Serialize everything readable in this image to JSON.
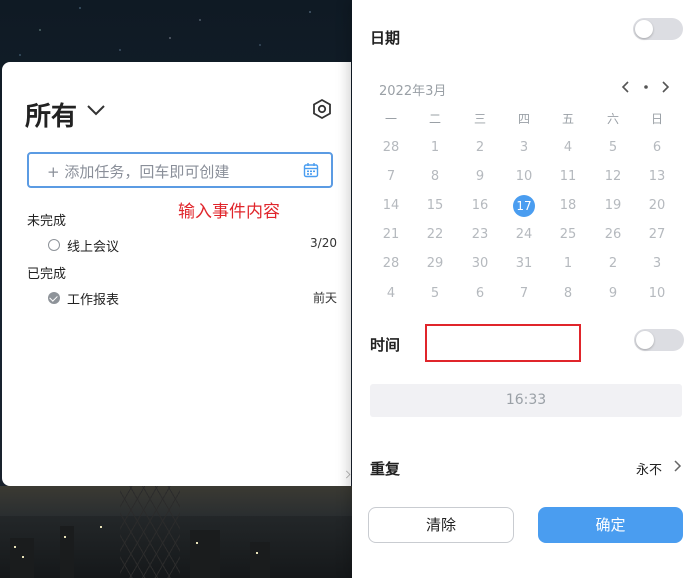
{
  "todo": {
    "list_title": "所有",
    "input_placeholder": "+ 添加任务，回车即可创建",
    "annotation": "输入事件内容",
    "sections": [
      {
        "label": "未完成",
        "tasks": [
          {
            "text": "线上会议",
            "date": "3/20",
            "done": false
          }
        ]
      },
      {
        "label": "已完成",
        "tasks": [
          {
            "text": "工作报表",
            "date": "前天",
            "done": true
          }
        ]
      }
    ]
  },
  "picker": {
    "date_label": "日期",
    "date_toggle_on": false,
    "month_label": "2022年3月",
    "weekdays": [
      "一",
      "二",
      "三",
      "四",
      "五",
      "六",
      "日"
    ],
    "weeks": [
      [
        "28",
        "1",
        "2",
        "3",
        "4",
        "5",
        "6"
      ],
      [
        "7",
        "8",
        "9",
        "10",
        "11",
        "12",
        "13"
      ],
      [
        "14",
        "15",
        "16",
        "17",
        "18",
        "19",
        "20"
      ],
      [
        "21",
        "22",
        "23",
        "24",
        "25",
        "26",
        "27"
      ],
      [
        "28",
        "29",
        "30",
        "31",
        "1",
        "2",
        "3"
      ],
      [
        "4",
        "5",
        "6",
        "7",
        "8",
        "9",
        "10"
      ]
    ],
    "today": "17",
    "time_label": "时间",
    "time_toggle_on": false,
    "time_value": "16:33",
    "repeat_label": "重复",
    "repeat_value": "永不",
    "clear_button": "清除",
    "confirm_button": "确定"
  },
  "colors": {
    "accent": "#4a9df0",
    "annotation": "#e0252b",
    "muted_text": "#b5b9be"
  }
}
